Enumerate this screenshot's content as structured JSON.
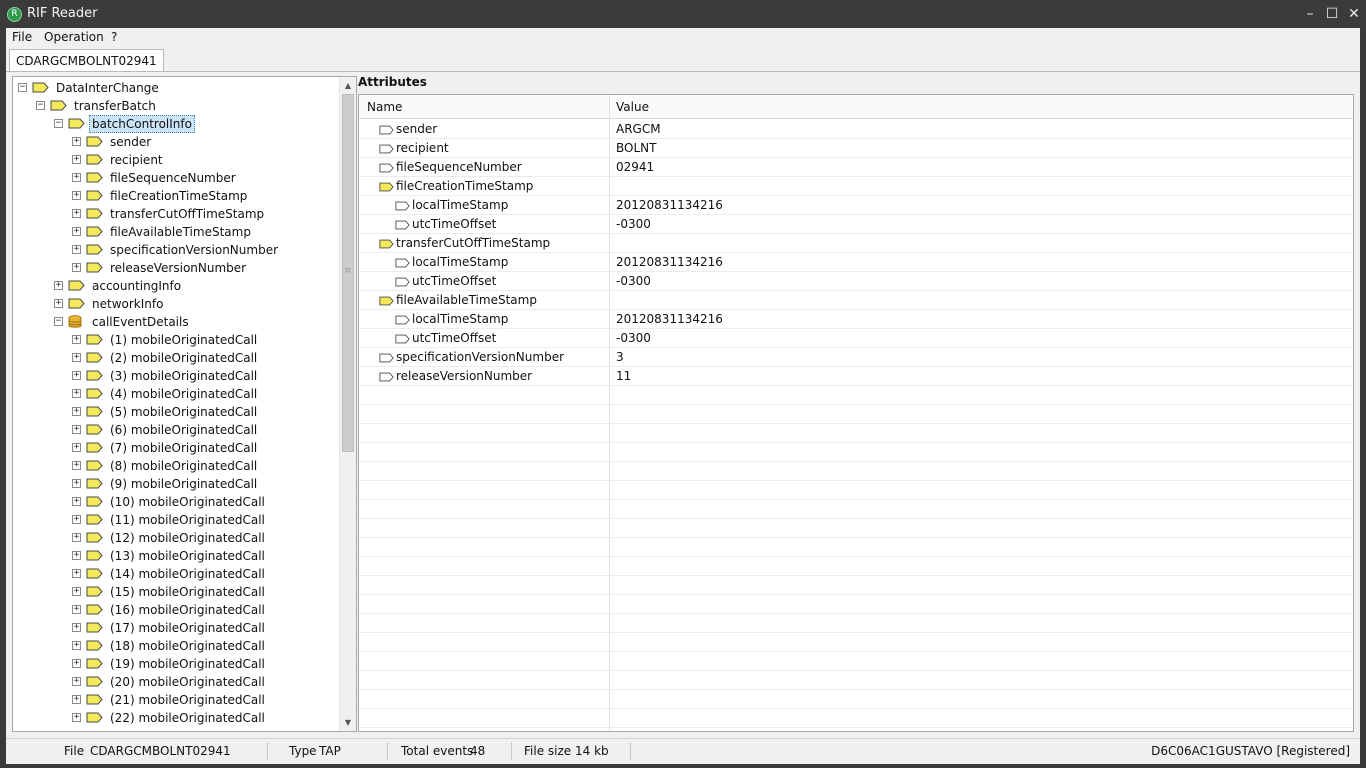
{
  "window": {
    "title": "RIF Reader",
    "minimize": "–",
    "maximize": "☐",
    "close": "✕"
  },
  "menu": [
    "File",
    "Operation",
    "?"
  ],
  "document_tab": "CDARGCMBOLNT02941",
  "tree": [
    {
      "label": "DataInterChange",
      "depth": 0,
      "expander": "minus",
      "icon": "folder",
      "selected": false
    },
    {
      "label": "transferBatch",
      "depth": 1,
      "expander": "minus",
      "icon": "folder",
      "selected": false
    },
    {
      "label": "batchControlInfo",
      "depth": 2,
      "expander": "minus",
      "icon": "folder",
      "selected": true
    },
    {
      "label": "sender",
      "depth": 3,
      "expander": "plus",
      "icon": "folder",
      "selected": false
    },
    {
      "label": "recipient",
      "depth": 3,
      "expander": "plus",
      "icon": "folder",
      "selected": false
    },
    {
      "label": "fileSequenceNumber",
      "depth": 3,
      "expander": "plus",
      "icon": "folder",
      "selected": false
    },
    {
      "label": "fileCreationTimeStamp",
      "depth": 3,
      "expander": "plus",
      "icon": "folder",
      "selected": false
    },
    {
      "label": "transferCutOffTimeStamp",
      "depth": 3,
      "expander": "plus",
      "icon": "folder",
      "selected": false
    },
    {
      "label": "fileAvailableTimeStamp",
      "depth": 3,
      "expander": "plus",
      "icon": "folder",
      "selected": false
    },
    {
      "label": "specificationVersionNumber",
      "depth": 3,
      "expander": "plus",
      "icon": "folder",
      "selected": false
    },
    {
      "label": "releaseVersionNumber",
      "depth": 3,
      "expander": "plus",
      "icon": "folder",
      "selected": false
    },
    {
      "label": "accountingInfo",
      "depth": 2,
      "expander": "plus",
      "icon": "folder",
      "selected": false
    },
    {
      "label": "networkInfo",
      "depth": 2,
      "expander": "plus",
      "icon": "folder",
      "selected": false
    },
    {
      "label": "callEventDetails",
      "depth": 2,
      "expander": "minus",
      "icon": "database",
      "selected": false
    },
    {
      "label": "(1) mobileOriginatedCall",
      "depth": 3,
      "expander": "plus",
      "icon": "folder",
      "selected": false
    },
    {
      "label": "(2) mobileOriginatedCall",
      "depth": 3,
      "expander": "plus",
      "icon": "folder",
      "selected": false
    },
    {
      "label": "(3) mobileOriginatedCall",
      "depth": 3,
      "expander": "plus",
      "icon": "folder",
      "selected": false
    },
    {
      "label": "(4) mobileOriginatedCall",
      "depth": 3,
      "expander": "plus",
      "icon": "folder",
      "selected": false
    },
    {
      "label": "(5) mobileOriginatedCall",
      "depth": 3,
      "expander": "plus",
      "icon": "folder",
      "selected": false
    },
    {
      "label": "(6) mobileOriginatedCall",
      "depth": 3,
      "expander": "plus",
      "icon": "folder",
      "selected": false
    },
    {
      "label": "(7) mobileOriginatedCall",
      "depth": 3,
      "expander": "plus",
      "icon": "folder",
      "selected": false
    },
    {
      "label": "(8) mobileOriginatedCall",
      "depth": 3,
      "expander": "plus",
      "icon": "folder",
      "selected": false
    },
    {
      "label": "(9) mobileOriginatedCall",
      "depth": 3,
      "expander": "plus",
      "icon": "folder",
      "selected": false
    },
    {
      "label": "(10) mobileOriginatedCall",
      "depth": 3,
      "expander": "plus",
      "icon": "folder",
      "selected": false
    },
    {
      "label": "(11) mobileOriginatedCall",
      "depth": 3,
      "expander": "plus",
      "icon": "folder",
      "selected": false
    },
    {
      "label": "(12) mobileOriginatedCall",
      "depth": 3,
      "expander": "plus",
      "icon": "folder",
      "selected": false
    },
    {
      "label": "(13) mobileOriginatedCall",
      "depth": 3,
      "expander": "plus",
      "icon": "folder",
      "selected": false
    },
    {
      "label": "(14) mobileOriginatedCall",
      "depth": 3,
      "expander": "plus",
      "icon": "folder",
      "selected": false
    },
    {
      "label": "(15) mobileOriginatedCall",
      "depth": 3,
      "expander": "plus",
      "icon": "folder",
      "selected": false
    },
    {
      "label": "(16) mobileOriginatedCall",
      "depth": 3,
      "expander": "plus",
      "icon": "folder",
      "selected": false
    },
    {
      "label": "(17) mobileOriginatedCall",
      "depth": 3,
      "expander": "plus",
      "icon": "folder",
      "selected": false
    },
    {
      "label": "(18) mobileOriginatedCall",
      "depth": 3,
      "expander": "plus",
      "icon": "folder",
      "selected": false
    },
    {
      "label": "(19) mobileOriginatedCall",
      "depth": 3,
      "expander": "plus",
      "icon": "folder",
      "selected": false
    },
    {
      "label": "(20) mobileOriginatedCall",
      "depth": 3,
      "expander": "plus",
      "icon": "folder",
      "selected": false
    },
    {
      "label": "(21) mobileOriginatedCall",
      "depth": 3,
      "expander": "plus",
      "icon": "folder",
      "selected": false
    },
    {
      "label": "(22) mobileOriginatedCall",
      "depth": 3,
      "expander": "plus",
      "icon": "folder",
      "selected": false
    }
  ],
  "attributes": {
    "title": "Attributes",
    "columns": [
      "Name",
      "Value"
    ],
    "rows": [
      {
        "name": "sender",
        "value": "ARGCM",
        "depth": 0,
        "kind": "leaf"
      },
      {
        "name": "recipient",
        "value": "BOLNT",
        "depth": 0,
        "kind": "leaf"
      },
      {
        "name": "fileSequenceNumber",
        "value": "02941",
        "depth": 0,
        "kind": "leaf"
      },
      {
        "name": "fileCreationTimeStamp",
        "value": "",
        "depth": 0,
        "kind": "group"
      },
      {
        "name": "localTimeStamp",
        "value": "20120831134216",
        "depth": 1,
        "kind": "leaf"
      },
      {
        "name": "utcTimeOffset",
        "value": "-0300",
        "depth": 1,
        "kind": "leaf"
      },
      {
        "name": "transferCutOffTimeStamp",
        "value": "",
        "depth": 0,
        "kind": "group"
      },
      {
        "name": "localTimeStamp",
        "value": "20120831134216",
        "depth": 1,
        "kind": "leaf"
      },
      {
        "name": "utcTimeOffset",
        "value": "-0300",
        "depth": 1,
        "kind": "leaf"
      },
      {
        "name": "fileAvailableTimeStamp",
        "value": "",
        "depth": 0,
        "kind": "group"
      },
      {
        "name": "localTimeStamp",
        "value": "20120831134216",
        "depth": 1,
        "kind": "leaf"
      },
      {
        "name": "utcTimeOffset",
        "value": "-0300",
        "depth": 1,
        "kind": "leaf"
      },
      {
        "name": "specificationVersionNumber",
        "value": "3",
        "depth": 0,
        "kind": "leaf"
      },
      {
        "name": "releaseVersionNumber",
        "value": "11",
        "depth": 0,
        "kind": "leaf"
      }
    ]
  },
  "status": {
    "file_label": "File",
    "file_value": "CDARGCMBOLNT02941",
    "type_label": "Type",
    "type_value": "TAP",
    "events_label": "Total events",
    "events_value": "48",
    "size_label": "File size",
    "size_value": "14 kb",
    "user": "D6C06AC1GUSTAVO [Registered]"
  },
  "colors": {
    "folder_fill": "#f4e95a",
    "selection": "#cce4f7",
    "titlebar": "#3b3b3b"
  }
}
